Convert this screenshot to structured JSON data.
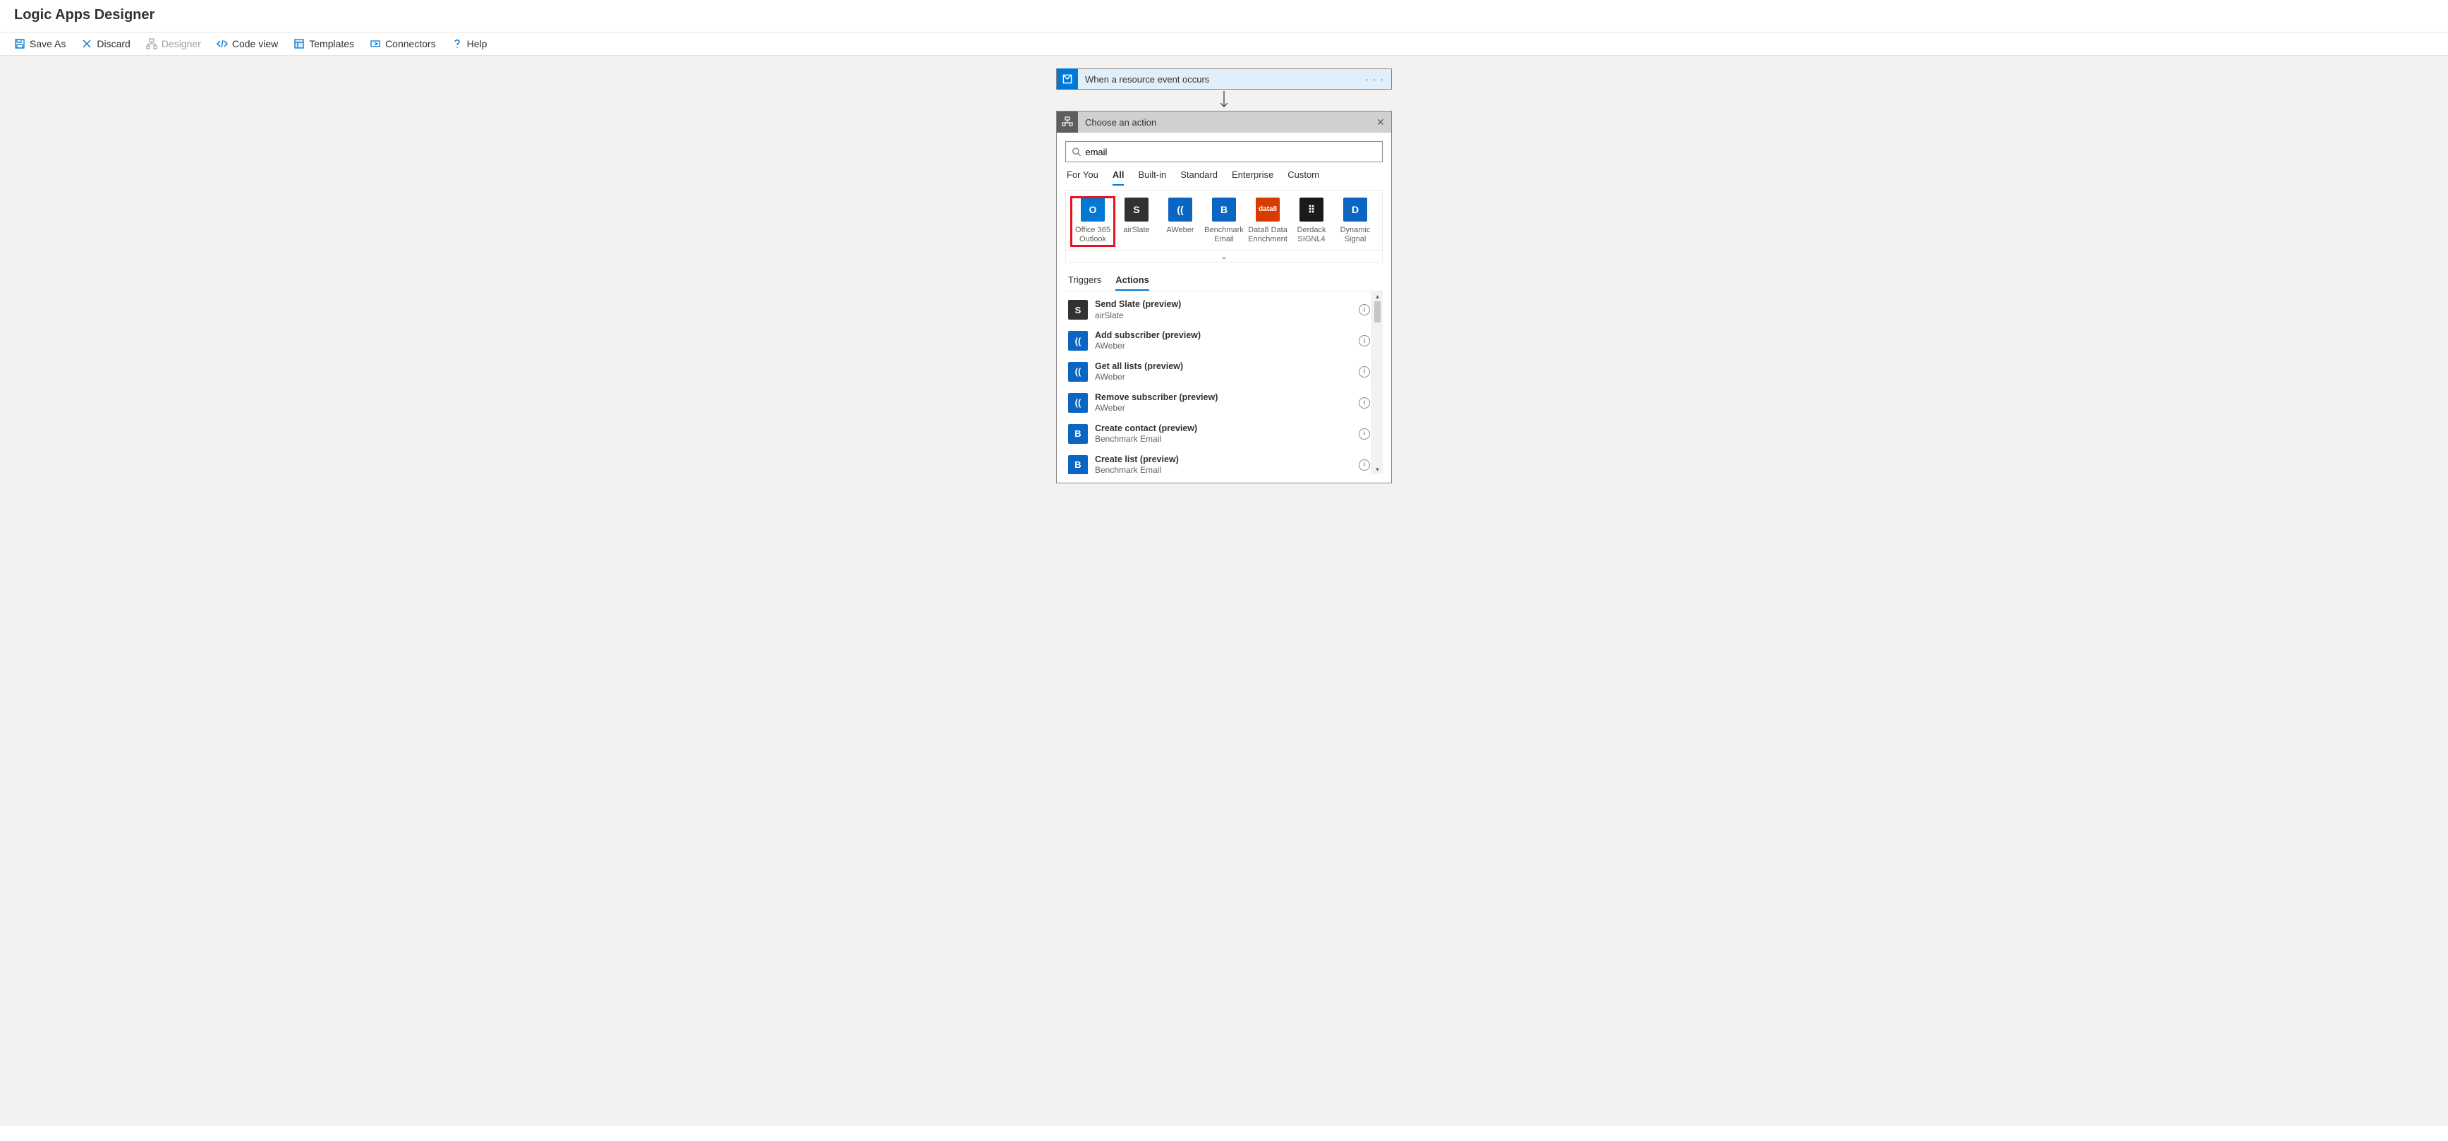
{
  "header": {
    "title": "Logic Apps Designer"
  },
  "toolbar": {
    "save_as": "Save As",
    "discard": "Discard",
    "designer": "Designer",
    "code_view": "Code view",
    "templates": "Templates",
    "connectors": "Connectors",
    "help": "Help"
  },
  "trigger": {
    "title": "When a resource event occurs"
  },
  "action_panel": {
    "title": "Choose an action",
    "search_value": "email",
    "filter_tabs": [
      "For You",
      "All",
      "Built-in",
      "Standard",
      "Enterprise",
      "Custom"
    ],
    "active_filter": "All",
    "connectors": [
      {
        "label": "Office 365 Outlook",
        "icon_text": "O",
        "class": "ic-outlook",
        "highlight": true
      },
      {
        "label": "airSlate",
        "icon_text": "S",
        "class": "ic-airslate"
      },
      {
        "label": "AWeber",
        "icon_text": "((",
        "class": "ic-aweber"
      },
      {
        "label": "Benchmark Email",
        "icon_text": "B",
        "class": "ic-benchmark"
      },
      {
        "label": "Data8 Data Enrichment",
        "icon_text": "data8",
        "class": "ic-data8"
      },
      {
        "label": "Derdack SIGNL4",
        "icon_text": "⠿",
        "class": "ic-derdack"
      },
      {
        "label": "Dynamic Signal",
        "icon_text": "D",
        "class": "ic-dynamic"
      }
    ],
    "result_tabs": [
      "Triggers",
      "Actions"
    ],
    "active_result_tab": "Actions",
    "actions": [
      {
        "title": "Send Slate (preview)",
        "sub": "airSlate",
        "class": "ic-airslate",
        "icon_text": "S"
      },
      {
        "title": "Add subscriber (preview)",
        "sub": "AWeber",
        "class": "ic-aweber",
        "icon_text": "(("
      },
      {
        "title": "Get all lists (preview)",
        "sub": "AWeber",
        "class": "ic-aweber",
        "icon_text": "(("
      },
      {
        "title": "Remove subscriber (preview)",
        "sub": "AWeber",
        "class": "ic-aweber",
        "icon_text": "(("
      },
      {
        "title": "Create contact (preview)",
        "sub": "Benchmark Email",
        "class": "ic-benchmark",
        "icon_text": "B"
      },
      {
        "title": "Create list (preview)",
        "sub": "Benchmark Email",
        "class": "ic-benchmark",
        "icon_text": "B"
      }
    ]
  }
}
